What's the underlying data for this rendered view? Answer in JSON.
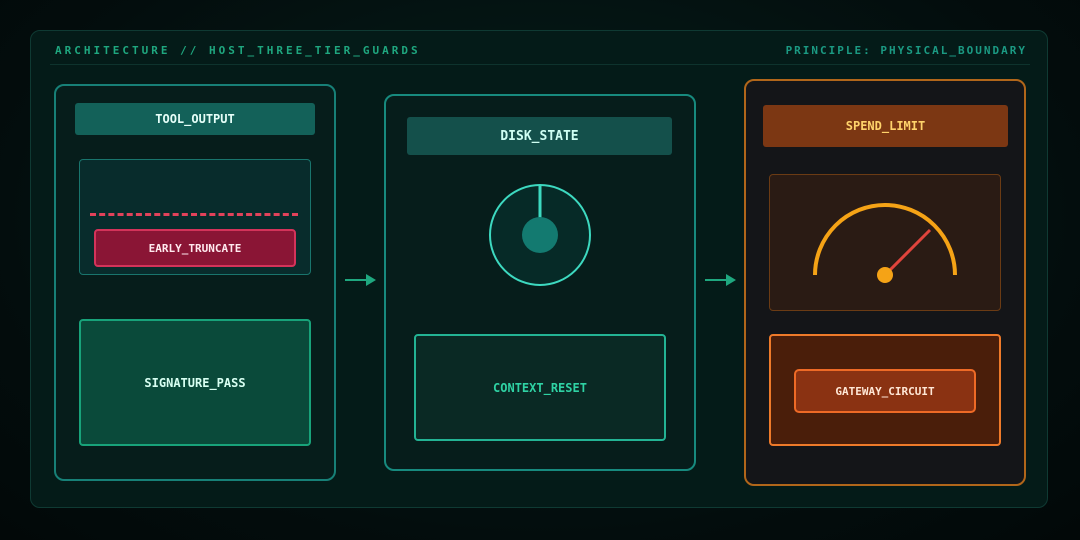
{
  "header": {
    "title": "ARCHITECTURE // HOST_THREE_TIER_GUARDS",
    "principle": "PRINCIPLE: PHYSICAL_BOUNDARY"
  },
  "tiers": [
    {
      "label": "TOOL_OUTPUT",
      "cutoff_label": "EARLY_TRUNCATE",
      "pass_label": "SIGNATURE_PASS"
    },
    {
      "label": "DISK_STATE",
      "reset_label": "CONTEXT_RESET"
    },
    {
      "label": "SPEND_LIMIT",
      "breaker_label": "GATEWAY_CIRCUIT"
    }
  ],
  "colors": {
    "teal_accent": "#1fa77f",
    "danger": "#e2425a",
    "warning": "#ee7a2a",
    "gauge": "#f5a316"
  },
  "icons": [
    "arrow-right-icon",
    "disk-icon",
    "speed-gauge-icon"
  ]
}
